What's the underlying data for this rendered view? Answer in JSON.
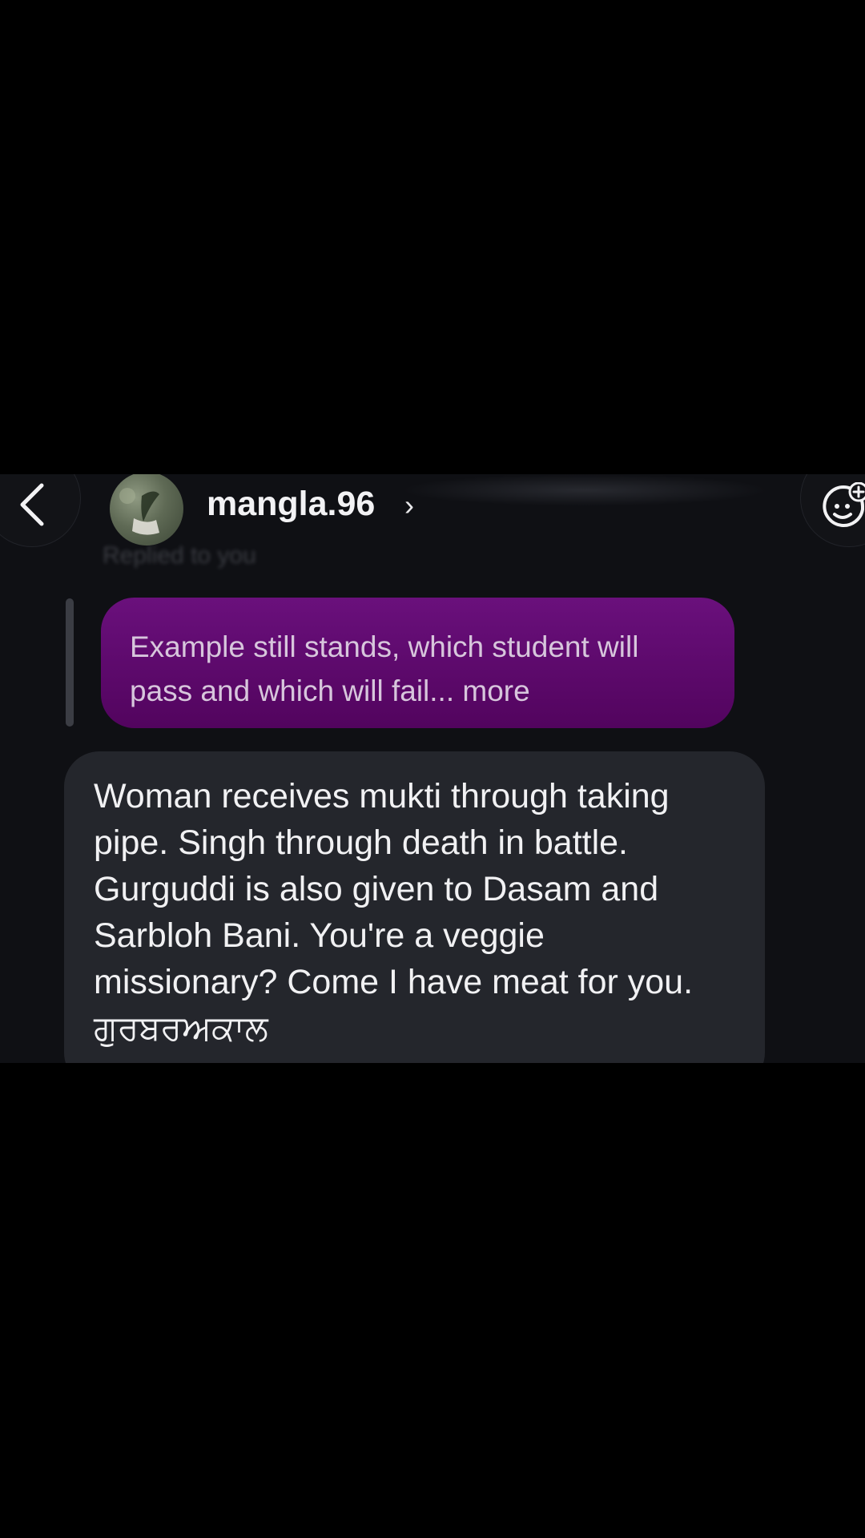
{
  "header": {
    "username": "mangla.96",
    "chevron": "›",
    "back_icon": "chevron-left-icon",
    "sticker_icon": "sticker-add-icon"
  },
  "reply": {
    "label": "Replied to you",
    "quoted_text": "Example still stands, which student will pass and which will fail...",
    "more_label": "more"
  },
  "message": {
    "lines": [
      "Woman receives mukti through taking",
      "pipe. Singh through death in battle.",
      "Gurguddi is also given to Dasam and",
      "Sarbloh Bani. You're a veggie",
      "missionary? Come I have meat for you.",
      "ਗੁਰਬਰਅਕਾਲ"
    ]
  },
  "colors": {
    "background": "#000000",
    "chat_background": "#0f1014",
    "quoted_bubble": "#5e0a6d",
    "received_bubble": "#24262c"
  }
}
